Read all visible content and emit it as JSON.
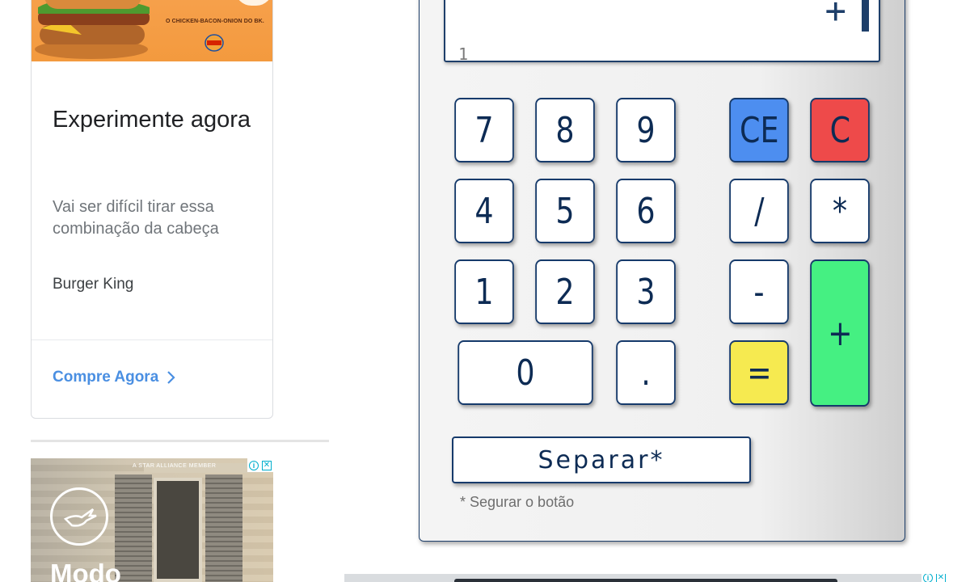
{
  "ads": {
    "burger_king": {
      "image_tagline": "O CHICKEN-BACON-ONION DO BK.",
      "logo_text": "BURGER KING",
      "title": "Experimente agora",
      "description": "Vai ser difícil tirar essa combinação da cabeça",
      "brand": "Burger King",
      "cta": "Compre Agora"
    },
    "lufthansa": {
      "partner_text": "A STAR ALLIANCE MEMBER",
      "headline": "Modo",
      "adchoices_info": "i",
      "adchoices_close": "✕"
    },
    "bottom": {
      "adchoices_info": "i",
      "adchoices_close": "✕"
    }
  },
  "calculator": {
    "display": {
      "expression": "+",
      "result": "1"
    },
    "keys": {
      "seven": "7",
      "eight": "8",
      "nine": "9",
      "four": "4",
      "five": "5",
      "six": "6",
      "one": "1",
      "two": "2",
      "three": "3",
      "zero": "0",
      "decimal": ".",
      "clear_entry": "CE",
      "clear": "C",
      "divide": "/",
      "multiply": "*",
      "subtract": "-",
      "add": "+",
      "equals": "="
    },
    "separar_label": "Separar*",
    "note": "* Segurar o botão"
  },
  "colors": {
    "accent_blue": "#4d8ef0",
    "accent_red": "#ee4a4a",
    "accent_yellow": "#f6ea50",
    "accent_green": "#45f082",
    "key_text": "#0d2b54",
    "cta_link": "#4a8fe2"
  },
  "icons": {
    "cta_chevron": "chevron-right-icon",
    "adchoices": "info-icon",
    "close": "close-icon"
  }
}
